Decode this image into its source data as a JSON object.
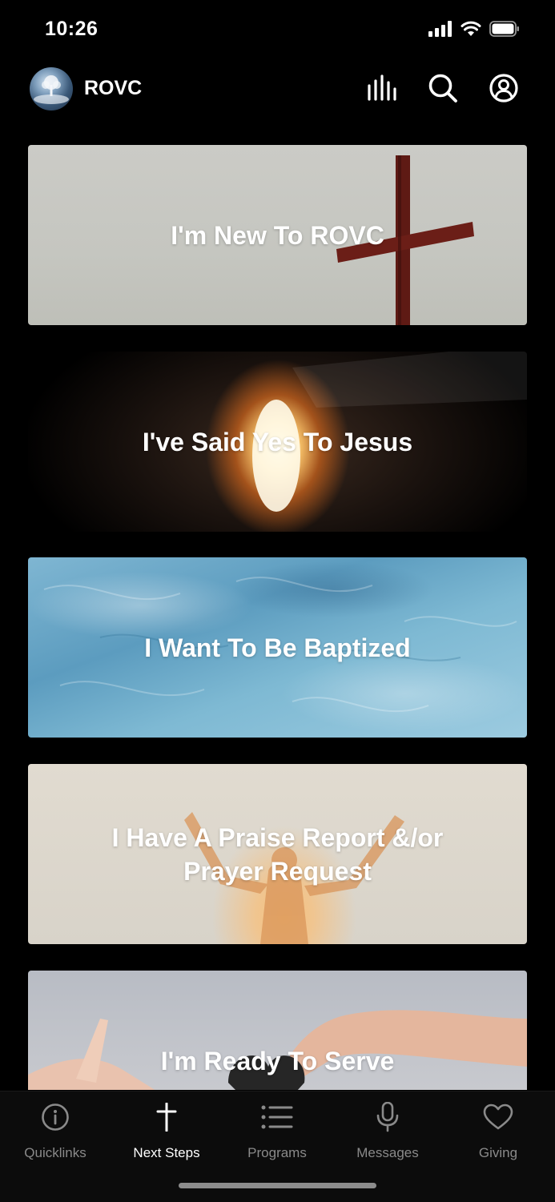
{
  "status_bar": {
    "time": "10:26",
    "icons": [
      "cellular-signal-icon",
      "wifi-icon",
      "battery-icon"
    ]
  },
  "header": {
    "app_name": "ROVC",
    "logo_icon": "church-logo-icon",
    "actions": [
      "audio-bars-icon",
      "search-icon",
      "profile-icon"
    ]
  },
  "cards": [
    {
      "title": "I'm New To ROVC",
      "image": "cross-on-hill"
    },
    {
      "title": "I've Said Yes To Jesus",
      "image": "empty-tomb-light"
    },
    {
      "title": "I Want To Be Baptized",
      "image": "water-surface"
    },
    {
      "title": "I Have A Praise Report &/or Prayer Request",
      "image": "person-raising-hands"
    },
    {
      "title": "I'm Ready To Serve",
      "image": "hands-passing-heart"
    }
  ],
  "tabs": [
    {
      "label": "Quicklinks",
      "icon": "info-circle-icon",
      "active": false
    },
    {
      "label": "Next Steps",
      "icon": "cross-icon",
      "active": true
    },
    {
      "label": "Programs",
      "icon": "list-icon",
      "active": false
    },
    {
      "label": "Messages",
      "icon": "microphone-icon",
      "active": false
    },
    {
      "label": "Giving",
      "icon": "heart-icon",
      "active": false
    }
  ],
  "colors": {
    "background": "#000000",
    "tab_active": "#ffffff",
    "tab_inactive": "#8a8a8a"
  }
}
